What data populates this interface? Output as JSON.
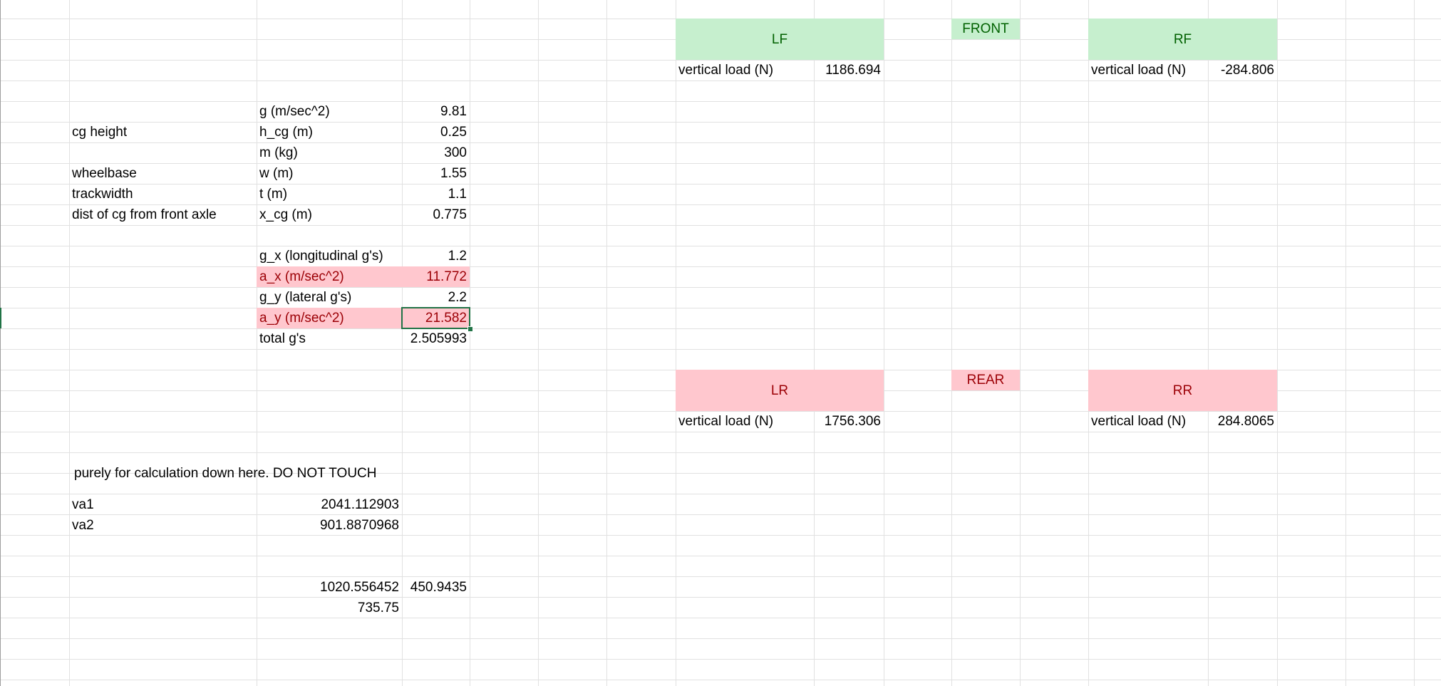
{
  "params": {
    "g_label": "g (m/sec^2)",
    "g_value": "9.81",
    "cg_height_desc": "cg height",
    "h_cg_label": "h_cg (m)",
    "h_cg_value": "0.25",
    "m_label": "m (kg)",
    "m_value": "300",
    "wheelbase_desc": "wheelbase",
    "w_label": "w (m)",
    "w_value": "1.55",
    "trackwidth_desc": "trackwidth",
    "t_label": "t (m)",
    "t_value": "1.1",
    "dist_cg_desc": "dist of cg from front axle",
    "x_cg_label": "x_cg (m)",
    "x_cg_value": "0.775",
    "gx_label": "g_x (longitudinal g's)",
    "gx_value": "1.2",
    "ax_label": "a_x (m/sec^2)",
    "ax_value": "11.772",
    "gy_label": "g_y (lateral g's)",
    "gy_value": "2.2",
    "ay_label": "a_y (m/sec^2)",
    "ay_value": "21.582",
    "total_label": "total g's",
    "total_value": "2.505993"
  },
  "calc": {
    "note": "purely for calculation down here. DO NOT TOUCH",
    "va1_label": "va1",
    "va1_value": "2041.112903",
    "va2_label": "va2",
    "va2_value": "901.8870968",
    "val_a": "1020.556452",
    "val_b": "450.9435",
    "val_c": "735.75"
  },
  "wheels": {
    "front_label": "FRONT",
    "rear_label": "REAR",
    "load_label": "vertical load (N)",
    "lf_label": "LF",
    "lf_load": "1186.694",
    "rf_label": "RF",
    "rf_load": "-284.806",
    "lr_label": "LR",
    "lr_load": "1756.306",
    "rr_label": "RR",
    "rr_load": "284.8065"
  },
  "colors": {
    "green_fill": "#c6efce",
    "green_text": "#006100",
    "red_fill": "#ffc7ce",
    "red_text": "#9c0006",
    "selection": "#217346"
  }
}
